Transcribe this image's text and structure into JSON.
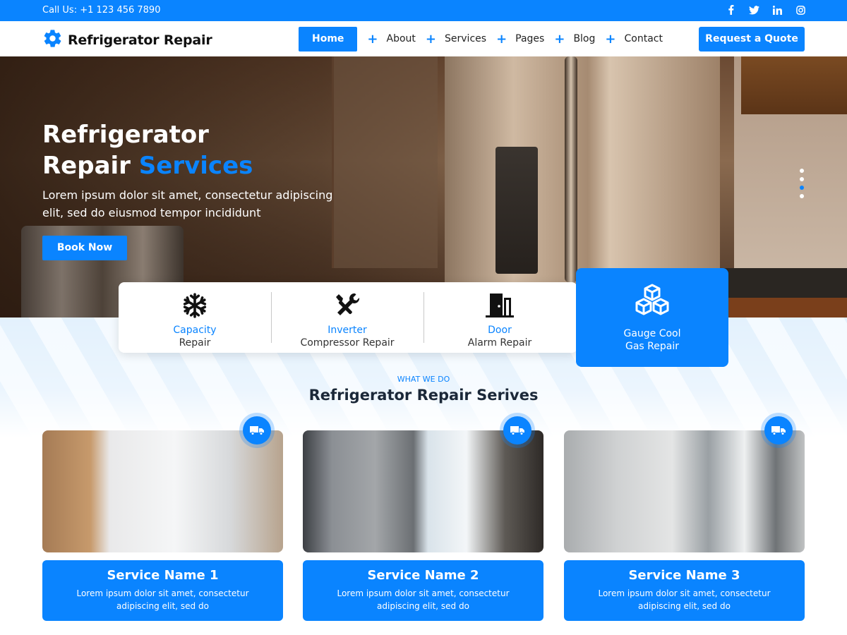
{
  "topbar": {
    "phone": "Call Us: +1 123 456 7890"
  },
  "socials": [
    "facebook-icon",
    "twitter-icon",
    "linkedin-icon",
    "instagram-icon"
  ],
  "header": {
    "brand": "Refrigerator Repair",
    "nav": {
      "home": "Home",
      "items": [
        "About",
        "Services",
        "Pages",
        "Blog",
        "Contact"
      ]
    },
    "cta": "Request a Quote"
  },
  "hero": {
    "title_line1": "Refrigerator",
    "title_line2a": "Repair ",
    "title_line2b": "Services",
    "subtitle": "Lorem ipsum dolor sit amet, consectetur adipiscing elit, sed do eiusmod tempor incididunt",
    "button": "Book Now",
    "slide_count": 4,
    "active_slide": 3
  },
  "features": [
    {
      "icon": "snowflake-icon",
      "line1": "Capacity",
      "line2": "Repair"
    },
    {
      "icon": "tools-icon",
      "line1": "Inverter",
      "line2": "Compressor Repair"
    },
    {
      "icon": "door-icon",
      "line1": "Door",
      "line2": "Alarm Repair"
    },
    {
      "icon": "cubes-icon",
      "line1": "Gauge Cool",
      "line2": "Gas Repair"
    }
  ],
  "services_section": {
    "eyebrow": "WHAT WE DO",
    "title": "Refrigerator Repair Serives",
    "cards": [
      {
        "name": "Service Name 1",
        "desc": "Lorem ipsum dolor sit amet, consectetur adipiscing elit, sed do",
        "badge_icon": "truck-icon"
      },
      {
        "name": "Service Name 2",
        "desc": "Lorem ipsum dolor sit amet, consectetur adipiscing elit, sed do",
        "badge_icon": "truck-icon"
      },
      {
        "name": "Service Name 3",
        "desc": "Lorem ipsum dolor sit amet, consectetur adipiscing elit, sed do",
        "badge_icon": "truck-icon"
      }
    ]
  },
  "colors": {
    "accent": "#0a84ff",
    "dark_text": "#1b2838"
  }
}
